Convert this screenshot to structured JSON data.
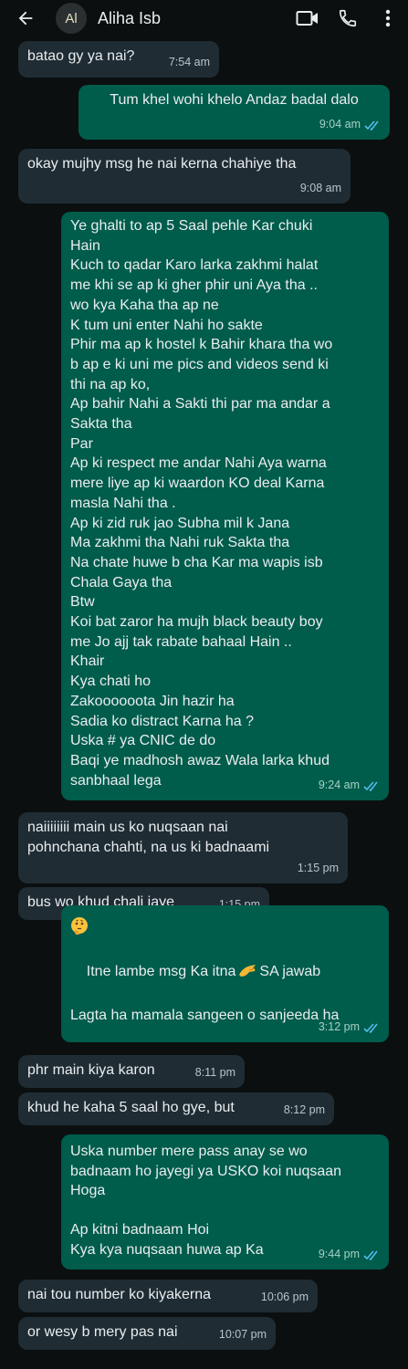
{
  "header": {
    "avatar_initials": "Al",
    "contact_name": "Aliha Isb",
    "icons": [
      "back-arrow-icon",
      "video-call-icon",
      "phone-icon",
      "more-vert-icon"
    ]
  },
  "colors": {
    "background": "#0b0f10",
    "incoming_bubble": "#1f2c33",
    "outgoing_bubble": "#005c4b",
    "read_ticks": "#53bdeb"
  },
  "messages": [
    {
      "dir": "in",
      "text": "batao gy ya nai?",
      "time": "7:54 am"
    },
    {
      "dir": "out",
      "text": "Tum khel wohi khelo Andaz badal dalo",
      "time": "9:04 am",
      "status": "read"
    },
    {
      "dir": "in",
      "text": "okay mujhy msg he nai kerna chahiye tha",
      "time": "9:08 am"
    },
    {
      "dir": "out",
      "text": "Ye ghalti to ap 5 Saal pehle Kar chuki\nHain\nKuch to qadar Karo larka zakhmi halat\nme khi se ap ki gher phir uni Aya tha ..\nwo kya Kaha tha ap ne\nK tum uni enter Nahi ho sakte\nPhir ma ap k hostel k Bahir khara tha wo\nb ap e ki uni me pics and videos send ki\nthi na ap ko,\nAp bahir Nahi a Sakti thi par ma andar a\nSakta tha\nPar\nAp ki respect me andar Nahi Aya warna\nmere liye ap ki waardon KO deal Karna\nmasla Nahi tha .\nAp ki zid ruk jao Subha mil k Jana\nMa zakhmi tha Nahi ruk Sakta tha\nNa chate huwe b cha Kar ma wapis isb\nChala Gaya tha\nBtw\nKoi bat zaror ha mujh black beauty boy\nme Jo ajj tak rabate bahaal Hain ..\nKhair\nKya chati ho\nZakoooooota Jin hazir ha\nSadia ko distract Karna ha ?\nUska # ya CNIC de do\nBaqi ye madhosh awaz Wala larka khud\nsanbhaal lega",
      "time": "9:24 am",
      "status": "read"
    },
    {
      "dir": "in",
      "text": "naiiiiiiii main us ko nuqsaan nai\npohnchana chahti, na us ki badnaami",
      "time": "1:15 pm"
    },
    {
      "dir": "in",
      "text": "bus wo khud chali jaye",
      "time": "1:15 pm"
    },
    {
      "dir": "out",
      "emoji": "thinking-face-emoji",
      "text_before": "Itne lambe msg Ka itna",
      "hand_emoji": "pinching-hand-emoji",
      "text_after": "SA jawab",
      "text_line2": "Lagta ha mamala sangeen o sanjeeda ha",
      "time": "3:12 pm",
      "status": "read"
    },
    {
      "dir": "in",
      "text": "phr main kiya karon",
      "time": "8:11 pm"
    },
    {
      "dir": "in",
      "text": "khud he kaha 5 saal ho gye, but",
      "time": "8:12 pm"
    },
    {
      "dir": "out",
      "text": "Uska number mere pass anay se wo\nbadnaam ho jayegi ya USKO koi nuqsaan\nHoga\n\nAp kitni badnaam Hoi\nKya kya nuqsaan huwa ap Ka",
      "time": "9:44 pm",
      "status": "read"
    },
    {
      "dir": "in",
      "text": "nai tou number ko kiyakerna",
      "time": "10:06 pm"
    },
    {
      "dir": "in",
      "text": "or wesy b mery pas nai",
      "time": "10:07 pm"
    }
  ]
}
